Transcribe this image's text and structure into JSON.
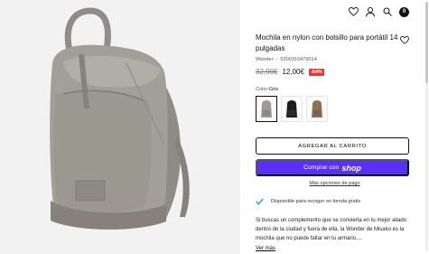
{
  "product": {
    "title": "Mochila en nylon con bolsillo para portátil 14 pulgadas",
    "brand": "Wonder",
    "separator": "-",
    "sku": "5200310479014",
    "old_price": "32,90€",
    "new_price": "12,00€",
    "discount": "-64%",
    "color_label": "Color:",
    "color_value": "Gris"
  },
  "swatches": [
    {
      "name": "gris",
      "color": "#9c9a92"
    },
    {
      "name": "negro",
      "color": "#1c1c1c"
    },
    {
      "name": "marron",
      "color": "#8a7355"
    }
  ],
  "actions": {
    "add_to_cart": "AGREGAR AL CARRITO",
    "shop_pay_prefix": "Comprar con",
    "shop_pay_brand": "shop",
    "more_payment": "Más opciones de pago"
  },
  "pickup": {
    "text": "Disponible para recoger en tienda gratis"
  },
  "description": {
    "text": "Si buscas un complemento que se convierta en tu mejor aliado dentro de la ciudad y fuera de ella, la Wonder de Misako es la mochila que no puede faltar en tu armario....",
    "more": "Ver más"
  },
  "header": {
    "cart_count": "0",
    "icons": [
      "heart-icon",
      "user-icon",
      "search-icon",
      "cart-icon"
    ]
  },
  "colors": {
    "accent_shop": "#5a31f4",
    "discount": "#e53935",
    "check": "#2eb67d"
  }
}
